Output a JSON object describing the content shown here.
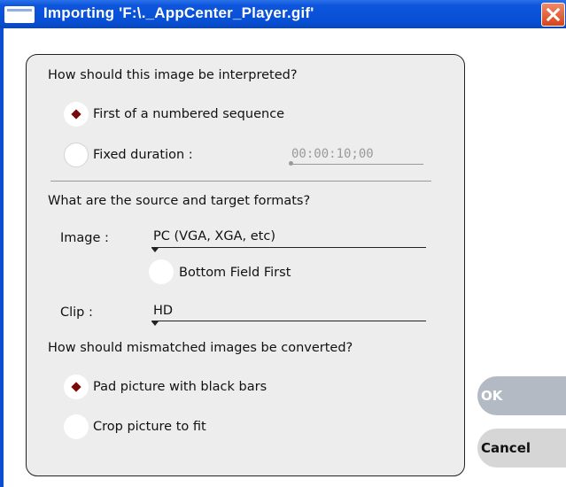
{
  "window": {
    "title": "Importing 'F:\\._AppCenter_Player.gif'"
  },
  "interpretation": {
    "question": "How should this image be interpreted?",
    "options": [
      {
        "label": "First of a numbered sequence",
        "selected": true
      },
      {
        "label": "Fixed duration :",
        "selected": false
      }
    ],
    "duration_value": "00:00:10;00"
  },
  "formats": {
    "question": "What are the source and target formats?",
    "image_label": "Image :",
    "image_value": "PC (VGA, XGA, etc)",
    "bottom_field_first_label": "Bottom Field First",
    "bottom_field_first_checked": false,
    "clip_label": "Clip :",
    "clip_value": "HD"
  },
  "conversion": {
    "question": "How should mismatched images be converted?",
    "options": [
      {
        "label": "Pad picture with black bars",
        "selected": true
      },
      {
        "label": "Crop picture to fit",
        "selected": false
      }
    ]
  },
  "buttons": {
    "ok": "OK",
    "cancel": "Cancel"
  },
  "colors": {
    "titlebar": "#0750d6",
    "selected_marker": "#7a0a0a",
    "close_button": "#d8431a"
  }
}
